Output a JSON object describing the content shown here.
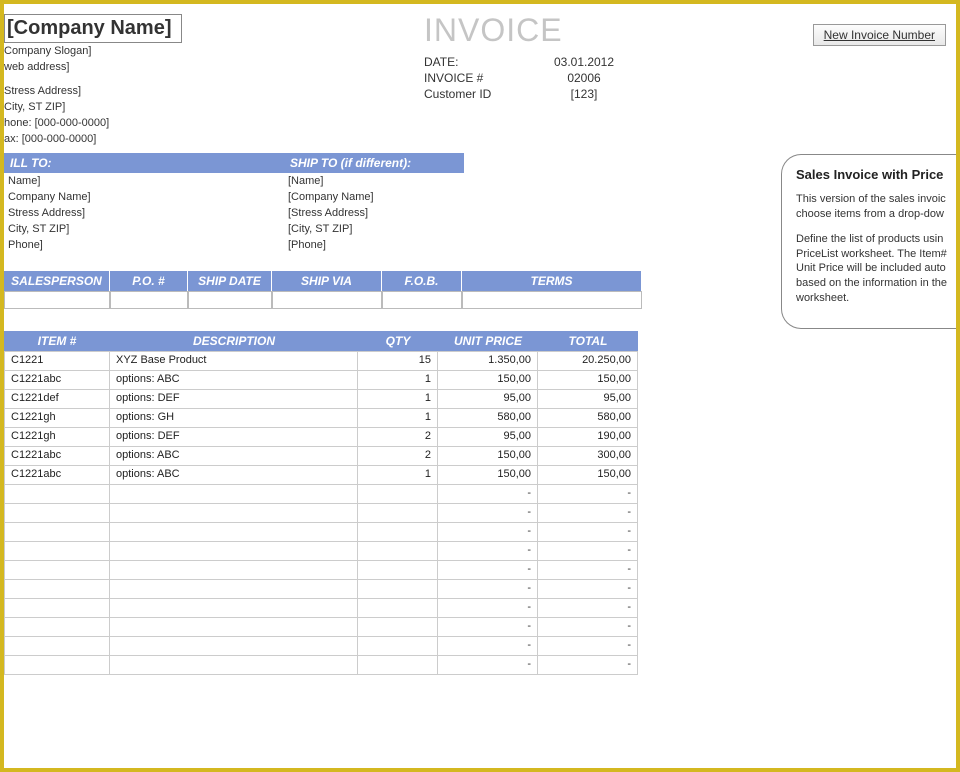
{
  "header": {
    "company_name": "[Company Name]",
    "slogan": "Company Slogan]",
    "web": "web address]",
    "street": "Stress Address]",
    "city": "City, ST  ZIP]",
    "phone": "hone: [000-000-0000]",
    "fax": "ax: [000-000-0000]"
  },
  "title": "INVOICE",
  "meta": {
    "date_label": "DATE:",
    "date_value": "03.01.2012",
    "invoice_label": "INVOICE #",
    "invoice_value": "02006",
    "customer_label": "Customer ID",
    "customer_value": "[123]"
  },
  "new_invoice_btn": "New Invoice Number",
  "billto": {
    "head": "ILL TO:",
    "name": "Name]",
    "company": "Company Name]",
    "street": "Stress Address]",
    "city": "City, ST  ZIP]",
    "phone": "Phone]"
  },
  "shipto": {
    "head": "SHIP TO (if different):",
    "name": "[Name]",
    "company": "[Company Name]",
    "street": "[Stress Address]",
    "city": "[City, ST  ZIP]",
    "phone": "[Phone]"
  },
  "sales_cols": {
    "salesperson": "SALESPERSON",
    "po": "P.O. #",
    "shipdate": "SHIP DATE",
    "shipvia": "SHIP VIA",
    "fob": "F.O.B.",
    "terms": "TERMS"
  },
  "item_cols": {
    "item": "ITEM #",
    "desc": "DESCRIPTION",
    "qty": "QTY",
    "unit": "UNIT PRICE",
    "total": "TOTAL"
  },
  "items": [
    {
      "item": "C1221",
      "desc": "XYZ Base Product",
      "qty": "15",
      "unit": "1.350,00",
      "total": "20.250,00"
    },
    {
      "item": "C1221abc",
      "desc": "options: ABC",
      "qty": "1",
      "unit": "150,00",
      "total": "150,00"
    },
    {
      "item": "C1221def",
      "desc": "options: DEF",
      "qty": "1",
      "unit": "95,00",
      "total": "95,00"
    },
    {
      "item": "C1221gh",
      "desc": "options: GH",
      "qty": "1",
      "unit": "580,00",
      "total": "580,00"
    },
    {
      "item": "C1221gh",
      "desc": "options: DEF",
      "qty": "2",
      "unit": "95,00",
      "total": "190,00"
    },
    {
      "item": "C1221abc",
      "desc": "options: ABC",
      "qty": "2",
      "unit": "150,00",
      "total": "300,00"
    },
    {
      "item": "C1221abc",
      "desc": "options: ABC",
      "qty": "1",
      "unit": "150,00",
      "total": "150,00"
    }
  ],
  "empty_rows": 10,
  "dash": "-",
  "sidenote": {
    "title": "Sales Invoice with Price",
    "p1": "This version of the sales invoic choose items from a drop-dow",
    "p2": "Define the list of products usin PriceList worksheet. The Item# Unit Price will be included auto based on the information in the worksheet."
  }
}
